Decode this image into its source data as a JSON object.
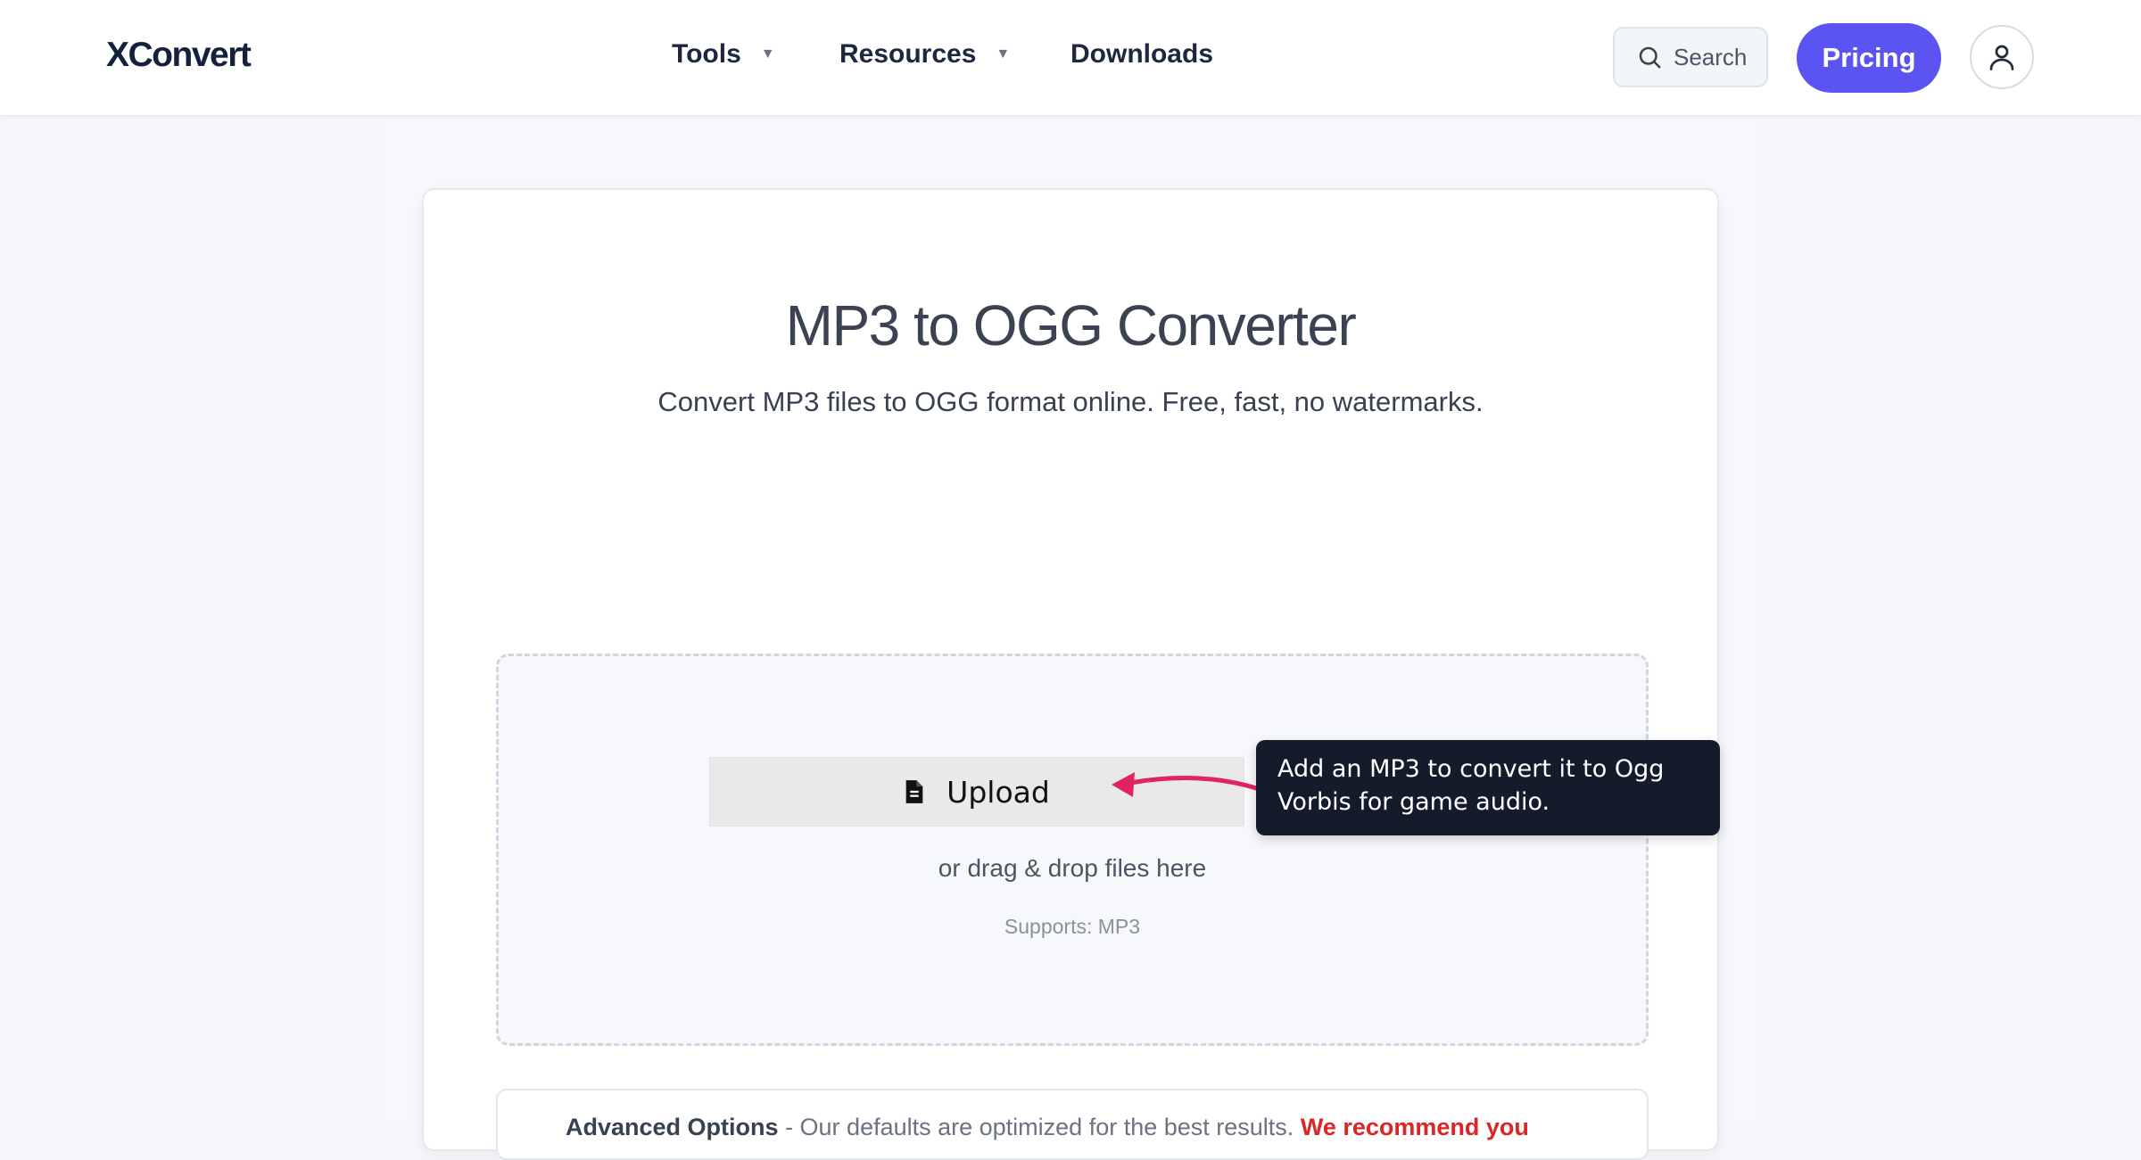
{
  "header": {
    "logo": "XConvert",
    "nav": [
      {
        "label": "Tools",
        "has_dropdown": true
      },
      {
        "label": "Resources",
        "has_dropdown": true
      },
      {
        "label": "Downloads",
        "has_dropdown": false
      }
    ],
    "dropdown_caret": "▼",
    "search_label": "Search",
    "search_icon": "search-icon",
    "pricing_label": "Pricing",
    "account_icon": "user-icon"
  },
  "main": {
    "title": "MP3 to OGG Converter",
    "subtitle": "Convert MP3 files to OGG format online. Free, fast, no watermarks.",
    "upload": {
      "label": "Upload",
      "icon": "file-icon",
      "drag_text": "or drag & drop files here",
      "supports": "Supports: MP3"
    },
    "advanced_options": {
      "heading": "Advanced Options",
      "text": "- Our defaults are optimized for the best results.",
      "recommendation": "We recommend you"
    }
  },
  "tooltip": {
    "text": "Add an MP3 to convert it to Ogg Vorbis for game audio."
  },
  "colors": {
    "brand": "#14213d",
    "accent": "#5b54f3",
    "tooltip_bg": "#141b2b",
    "arrow": "#e0245e",
    "recommend": "#dc2626"
  }
}
